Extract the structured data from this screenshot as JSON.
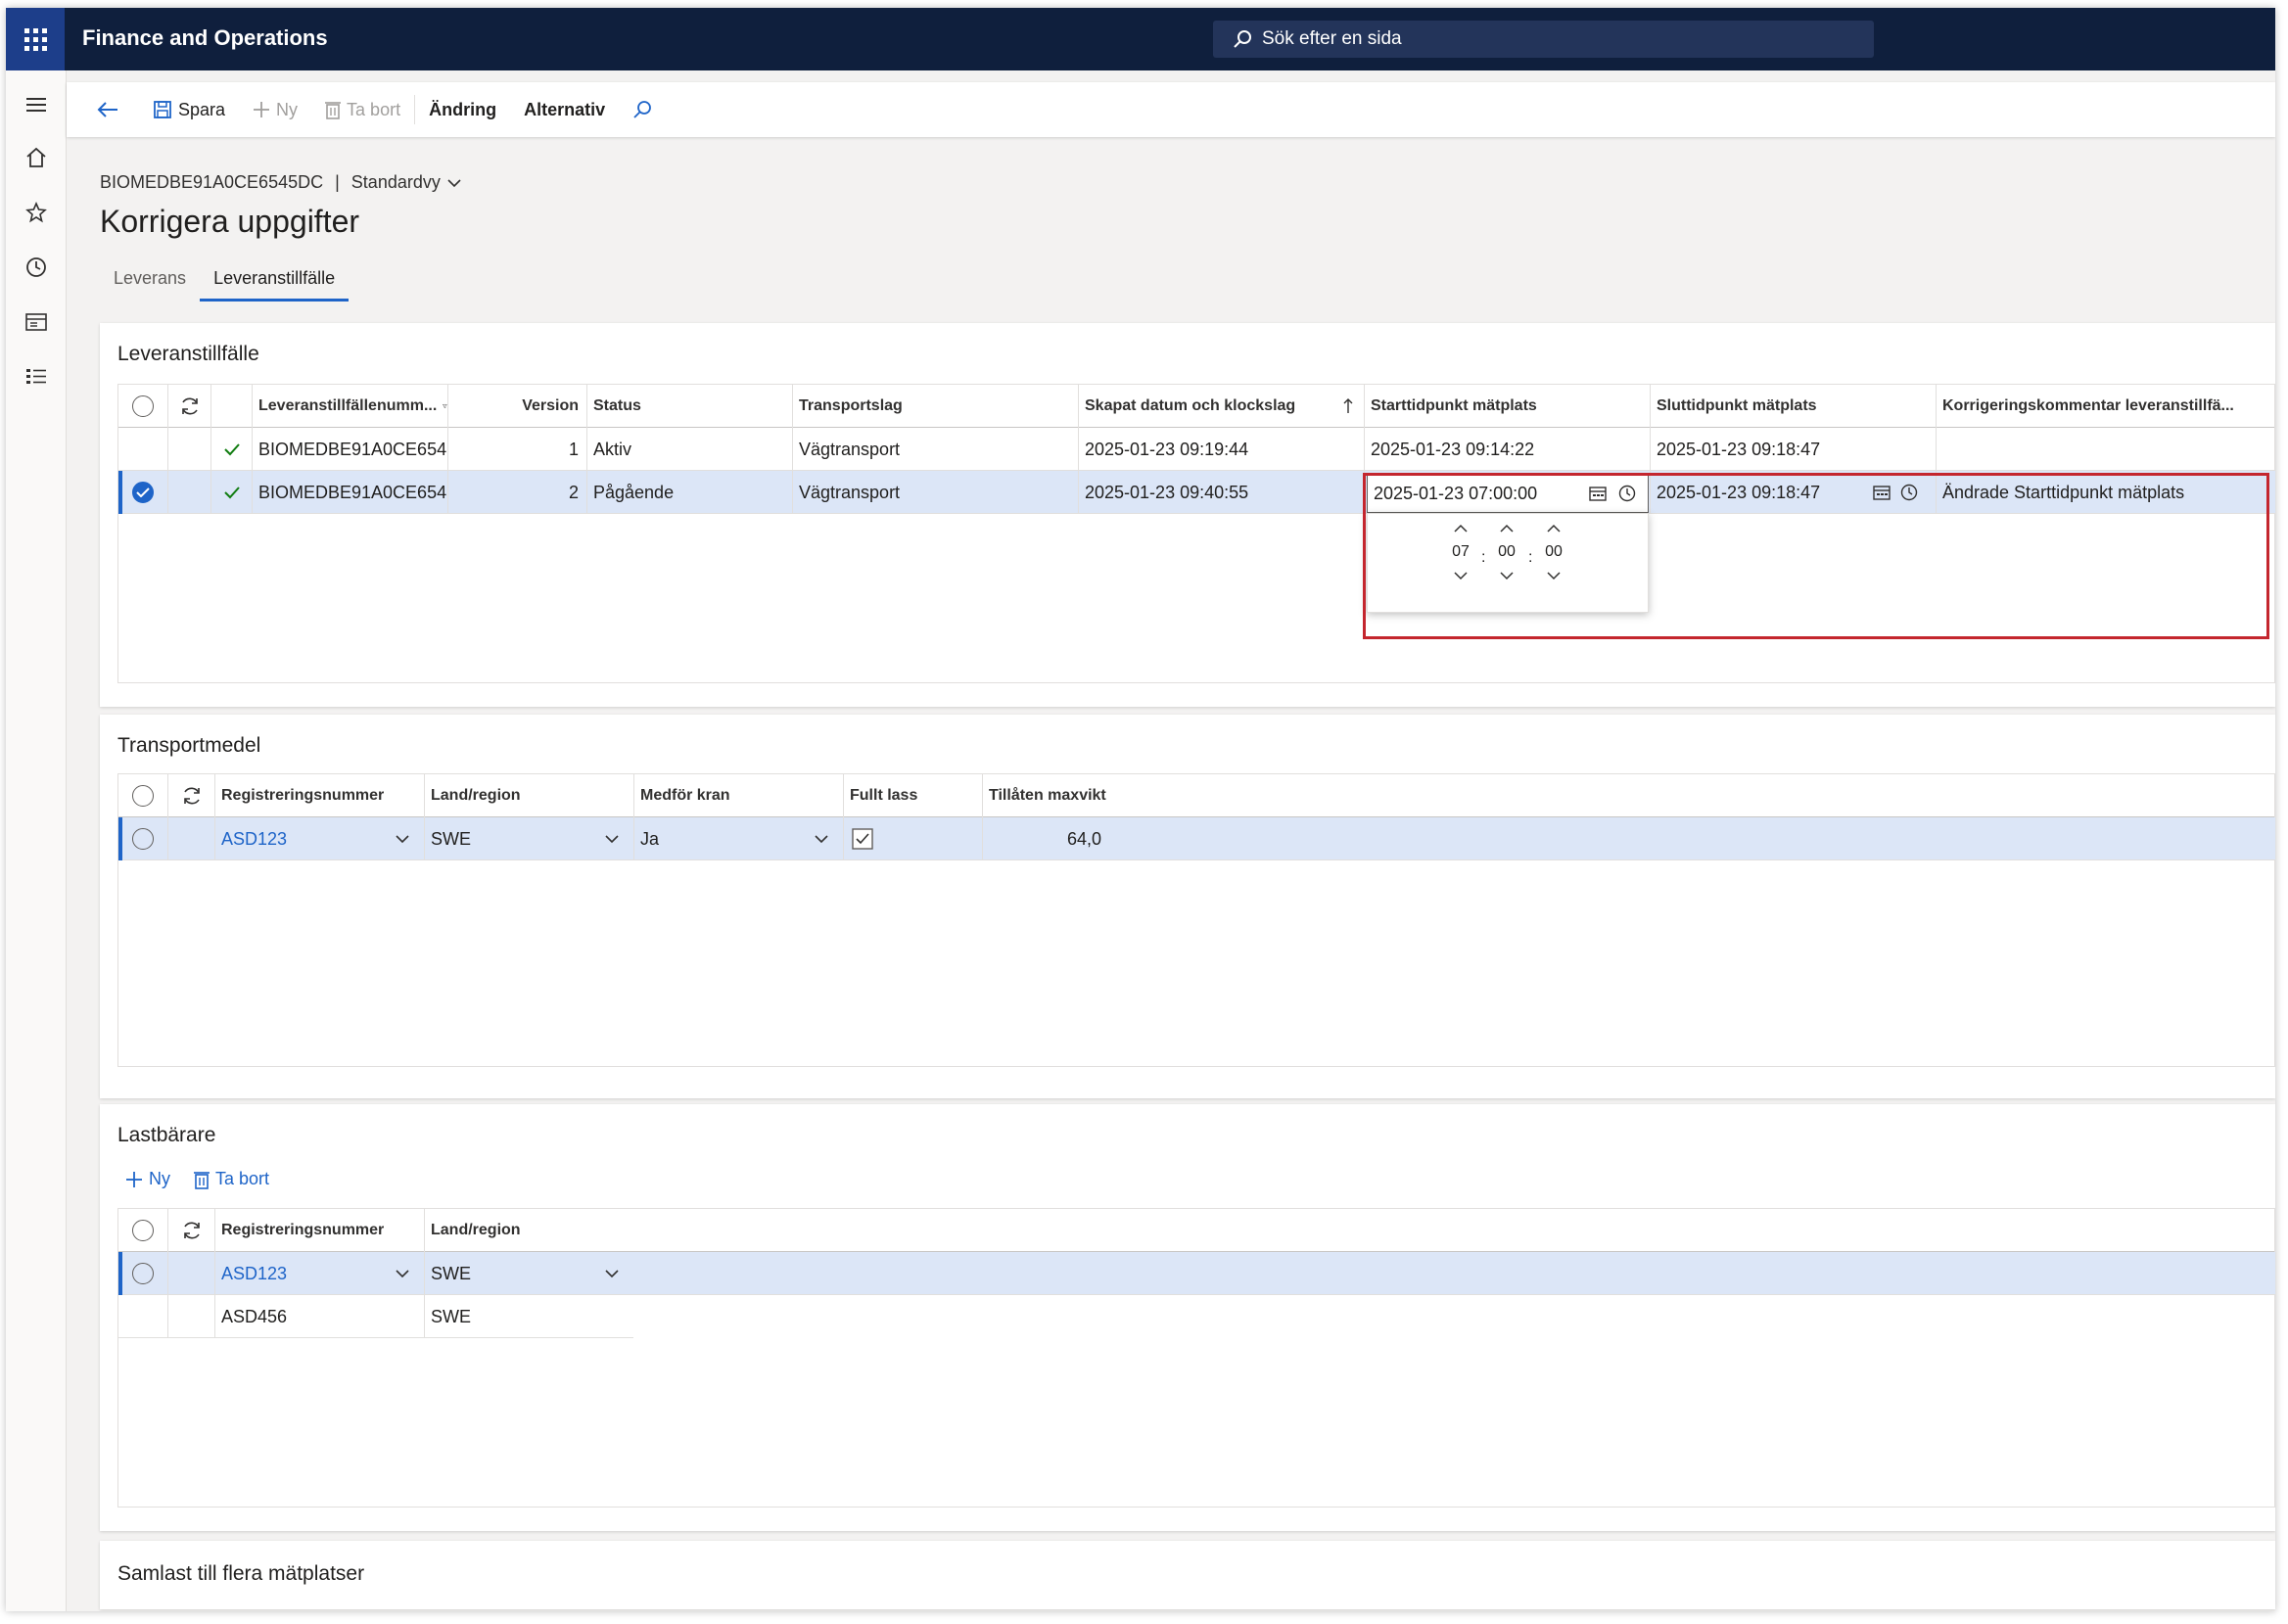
{
  "app": {
    "title": "Finance and Operations",
    "search_placeholder": "Sök efter en sida"
  },
  "actions": {
    "save": "Spara",
    "new": "Ny",
    "delete": "Ta bort",
    "change": "Ändring",
    "options": "Alternativ"
  },
  "breadcrumb": {
    "record": "BIOMEDBE91A0CE6545DC",
    "separator": "|",
    "view": "Standardvy"
  },
  "page": {
    "title": "Korrigera uppgifter"
  },
  "tabs": [
    {
      "label": "Leverans"
    },
    {
      "label": "Leveranstillfälle"
    }
  ],
  "section1": {
    "title": "Leveranstillfälle",
    "headers": {
      "number": "Leveranstillfällenumm...",
      "version": "Version",
      "status": "Status",
      "transport": "Transportslag",
      "created": "Skapat datum och klockslag",
      "start": "Starttidpunkt mätplats",
      "end": "Sluttidpunkt mätplats",
      "comment": "Korrigeringskommentar leveranstillfä..."
    },
    "rows": [
      {
        "number": "BIOMEDBE91A0CE654...",
        "version": "1",
        "status": "Aktiv",
        "transport": "Vägtransport",
        "created": "2025-01-23 09:19:44",
        "start": "2025-01-23 09:14:22",
        "end": "2025-01-23 09:18:47",
        "comment": ""
      },
      {
        "number": "BIOMEDBE91A0CE654...",
        "version": "2",
        "status": "Pågående",
        "transport": "Vägtransport",
        "created": "2025-01-23 09:40:55",
        "start": "2025-01-23 07:00:00",
        "end": "2025-01-23 09:18:47",
        "comment": "Ändrade Starttidpunkt mätplats"
      }
    ],
    "timepicker": {
      "hour": "07",
      "minute": "00",
      "second": "00",
      "sep": ":"
    }
  },
  "section2": {
    "title": "Transportmedel",
    "headers": {
      "reg": "Registreringsnummer",
      "country": "Land/region",
      "crane": "Medför kran",
      "full": "Fullt lass",
      "maxweight": "Tillåten maxvikt"
    },
    "rows": [
      {
        "reg": "ASD123",
        "country": "SWE",
        "crane": "Ja",
        "full": true,
        "maxweight": "64,0"
      }
    ]
  },
  "section3": {
    "title": "Lastbärare",
    "new": "Ny",
    "delete": "Ta bort",
    "headers": {
      "reg": "Registreringsnummer",
      "country": "Land/region"
    },
    "rows": [
      {
        "reg": "ASD123",
        "country": "SWE"
      },
      {
        "reg": "ASD456",
        "country": "SWE"
      }
    ]
  },
  "section4": {
    "title": "Samlast till flera mätplatser"
  },
  "colors": {
    "topbar": "#0f1f3d",
    "accent": "#1e64c8",
    "selected_row": "#dce6f7",
    "highlight": "#c4262e"
  }
}
